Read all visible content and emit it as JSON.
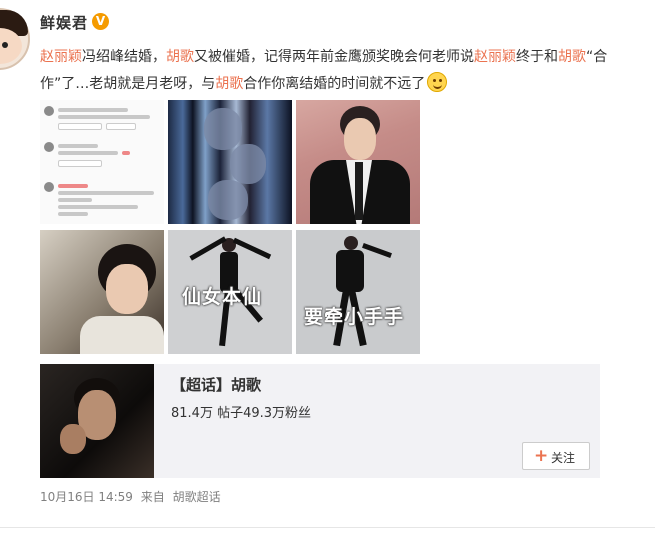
{
  "post": {
    "author": "鲜娱君",
    "verified_badge": "V",
    "text_lines": [
      [
        {
          "text": "赵丽颖",
          "link": true
        },
        {
          "text": "冯绍峰结婚，",
          "link": false
        },
        {
          "text": "胡歌",
          "link": true
        },
        {
          "text": "又被催婚，记得两年前金鹰颁奖晚会何老师说",
          "link": false
        },
        {
          "text": "赵丽颖",
          "link": true
        },
        {
          "text": "终于和",
          "link": false
        },
        {
          "text": "胡歌",
          "link": true
        },
        {
          "text": "“合",
          "link": false
        }
      ],
      [
        {
          "text": "作”了…老胡就是月老呀，与",
          "link": false
        },
        {
          "text": "胡歌",
          "link": true
        },
        {
          "text": "合作你离结婚的时间就不远了",
          "link": false
        }
      ]
    ],
    "emoji": "smile-emoji",
    "images": [
      {
        "name": "comment-screenshot"
      },
      {
        "name": "film-strip"
      },
      {
        "name": "suit-portrait"
      },
      {
        "name": "costume-drama-still"
      },
      {
        "name": "dance-pose",
        "caption": "仙女本仙"
      },
      {
        "name": "spin-pose",
        "caption": "要牵小手手"
      }
    ],
    "super_topic_card": {
      "title": "【超话】胡歌",
      "stats": "81.4万 帖子49.3万粉丝",
      "follow_label": "关注"
    },
    "meta": {
      "timestamp": "10月16日 14:59",
      "source_prefix": "来自",
      "source": "胡歌超话"
    }
  },
  "colors": {
    "link": "#eb7350",
    "text": "#333333",
    "meta": "#808080",
    "badge": "#f59b00",
    "card_bg": "#f2f2f5"
  }
}
